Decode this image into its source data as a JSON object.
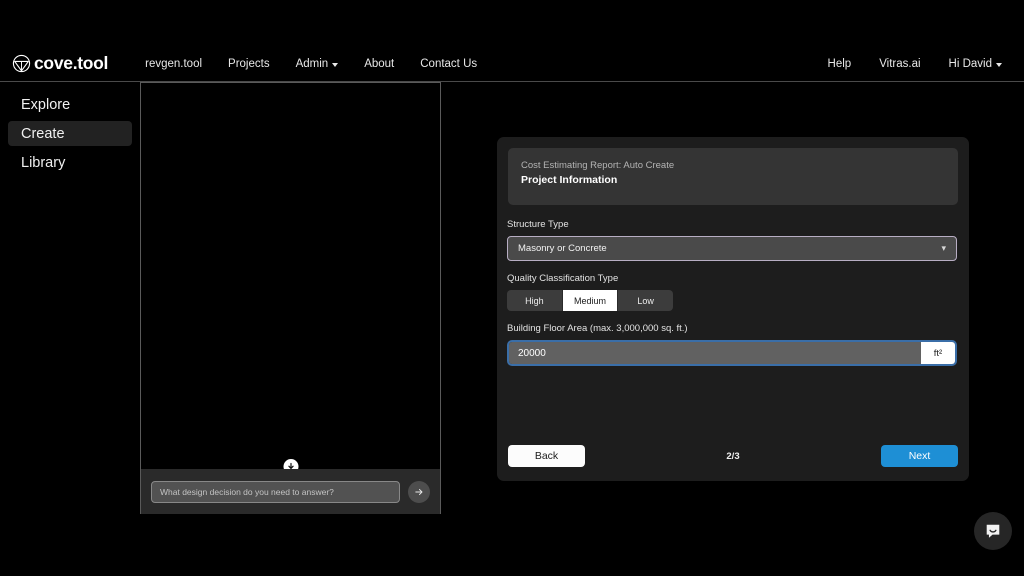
{
  "navbar": {
    "brand": "cove.tool",
    "brand_icon": "cove-logo-icon",
    "left_links": [
      {
        "label": "revgen.tool",
        "has_caret": false
      },
      {
        "label": "Projects",
        "has_caret": false
      },
      {
        "label": "Admin",
        "has_caret": true
      },
      {
        "label": "About",
        "has_caret": false
      },
      {
        "label": "Contact Us",
        "has_caret": false
      }
    ],
    "right_links": [
      {
        "label": "Help",
        "has_caret": false
      },
      {
        "label": "Vitras.ai",
        "has_caret": false
      },
      {
        "label": "Hi David",
        "has_caret": true
      }
    ]
  },
  "sidebar": {
    "items": [
      {
        "label": "Explore",
        "active": false
      },
      {
        "label": "Create",
        "active": true
      },
      {
        "label": "Library",
        "active": false
      }
    ]
  },
  "center_panel": {
    "scroll_down_icon": "arrow-down-circle-icon",
    "chat": {
      "placeholder": "What design decision do you need to answer?",
      "value": "",
      "send_icon": "arrow-right-icon"
    }
  },
  "modal": {
    "eyebrow": "Cost Estimating Report: Auto Create",
    "title": "Project Information",
    "fields": {
      "structure_type": {
        "label": "Structure Type",
        "value": "Masonry or Concrete",
        "chevron_icon": "chevron-down-icon"
      },
      "quality_classification": {
        "label": "Quality Classification Type",
        "options": [
          {
            "label": "High",
            "selected": false
          },
          {
            "label": "Medium",
            "selected": true
          },
          {
            "label": "Low",
            "selected": false
          }
        ]
      },
      "building_floor_area": {
        "label": "Building Floor Area (max. 3,000,000 sq. ft.)",
        "value": "20000",
        "unit": "ft²"
      }
    },
    "footer": {
      "back_label": "Back",
      "step": "2/3",
      "next_label": "Next"
    }
  },
  "launcher": {
    "icon": "intercom-chat-icon"
  },
  "colors": {
    "accent_blue": "#1e8fd5",
    "focus_blue": "#3a6ea8",
    "panel_bg": "#1d1d1d",
    "header_bg": "#343434",
    "page_bg": "#000000"
  }
}
